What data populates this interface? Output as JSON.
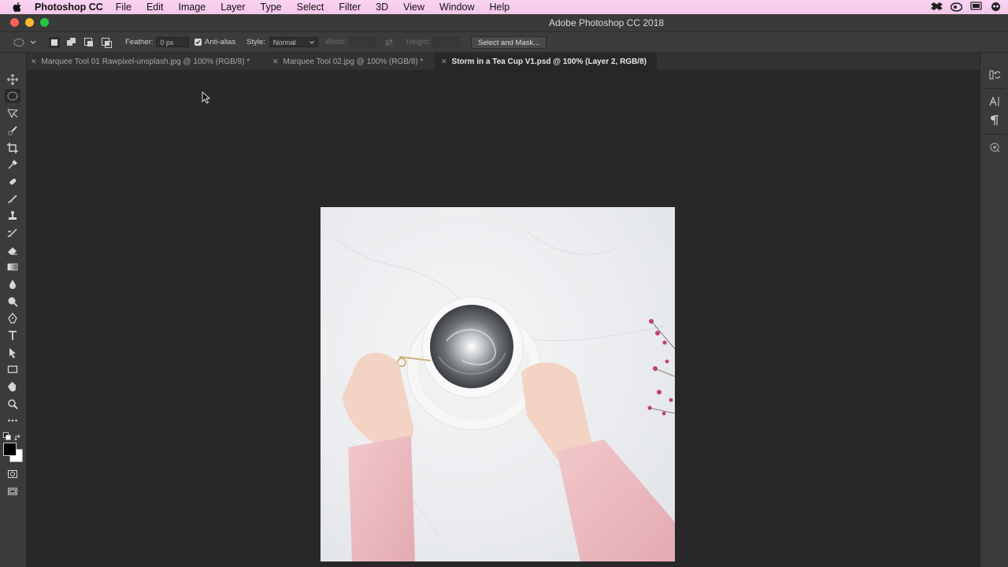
{
  "menubar": {
    "app_name": "Photoshop CC",
    "items": [
      "File",
      "Edit",
      "Image",
      "Layer",
      "Type",
      "Select",
      "Filter",
      "3D",
      "View",
      "Window",
      "Help"
    ]
  },
  "window": {
    "title": "Adobe Photoshop CC 2018"
  },
  "options_bar": {
    "feather_label": "Feather:",
    "feather_value": "0 px",
    "anti_alias_label": "Anti-alias",
    "anti_alias_checked": true,
    "style_label": "Style:",
    "style_value": "Normal",
    "width_label": "Width:",
    "height_label": "Height:",
    "select_mask_label": "Select and Mask..."
  },
  "tabs": [
    {
      "label": "Marquee Tool 01 Rawpixel-unsplash.jpg @ 100% (RGB/8) *",
      "active": false
    },
    {
      "label": "Marquee Tool 02.jpg @ 100% (RGB/8) *",
      "active": false
    },
    {
      "label": "Storm in a Tea Cup V1.psd @ 100% (Layer 2, RGB/8)",
      "active": true
    }
  ],
  "tools": [
    "move-tool",
    "elliptical-marquee-tool",
    "lasso-tool",
    "quick-selection-tool",
    "crop-tool",
    "eyedropper-tool",
    "healing-brush-tool",
    "brush-tool",
    "clone-stamp-tool",
    "history-brush-tool",
    "eraser-tool",
    "gradient-tool",
    "blur-tool",
    "dodge-tool",
    "pen-tool",
    "type-tool",
    "path-selection-tool",
    "rectangle-tool",
    "hand-tool",
    "zoom-tool",
    "edit-toolbar"
  ],
  "colors": {
    "menubar_bg": "#f7cdee",
    "chrome_bg": "#3b3b3b",
    "workspace_bg": "#282828",
    "foreground_color": "#000000",
    "background_color": "#ffffff"
  }
}
